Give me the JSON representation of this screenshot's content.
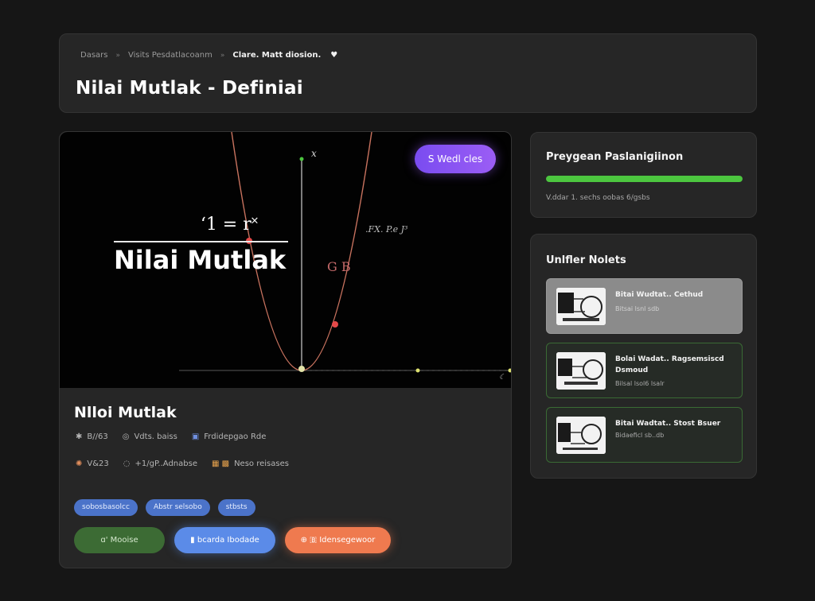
{
  "header": {
    "breadcrumb": [
      "Dasars",
      "Visits Pesdatlacoanm",
      "Clare. Matt diosion."
    ],
    "breadcrumb_sep": "»",
    "heart_icon": "♥",
    "title": "Nilai Mutlak - Definiai"
  },
  "video": {
    "formula": "ʻ1 = r˟",
    "title": "Nilai Mutlak",
    "badge": "S Wedl cles",
    "axis_label": "x",
    "fx_label": ".FX. P.e J³",
    "annotation": "G B",
    "corner_glyph": "☾"
  },
  "info": {
    "title": "Nlloi Mutlak",
    "meta_row_1": [
      {
        "icon": "✱",
        "text": "B//63"
      },
      {
        "icon": "◎",
        "text": "Vdts. baiss"
      },
      {
        "icon": "▣",
        "text": "Frdidepgao Rde"
      }
    ],
    "meta_row_2": [
      {
        "icon": "✺",
        "text": "V&23"
      },
      {
        "icon": "◌",
        "text": "+1/gP..Adnabse"
      },
      {
        "icon": "▦ ▩",
        "text": "Neso reisases"
      }
    ],
    "tags": [
      "sobosbasolcc",
      "Abstr selsobo",
      "stbsts"
    ],
    "actions": [
      "ɑ' Mooise",
      "▮  bcarda Ibodade",
      "⊕  🇧 Idensegewoor"
    ]
  },
  "progress": {
    "title": "Preygean Paslanigiinon",
    "percent": 100,
    "text": "V.ddar 1. sechs oobas 6/gsbs"
  },
  "related": {
    "title": "Unlfler Nolets",
    "items": [
      {
        "title": "Bitai Wudtat.. Cethud",
        "sub": "Bitsai lsnl sdb",
        "state": "active"
      },
      {
        "title": "Bolai Wadat.. Ragsemsiscd Dsmoud",
        "sub": "Bilsal lsol6 lsalr",
        "state": "normal"
      },
      {
        "title": "Bitai Wadtat.. Stost Bsuer",
        "sub": "Bidaeficl sb..db",
        "state": "normal"
      }
    ]
  },
  "colors": {
    "accent_purple": "#8a55f3",
    "progress_green": "#4cc63f",
    "tag_blue": "#4b73c9",
    "btn_green": "#3c6b34",
    "btn_blue": "#5b8be8",
    "btn_orange": "#ef7a4f"
  }
}
